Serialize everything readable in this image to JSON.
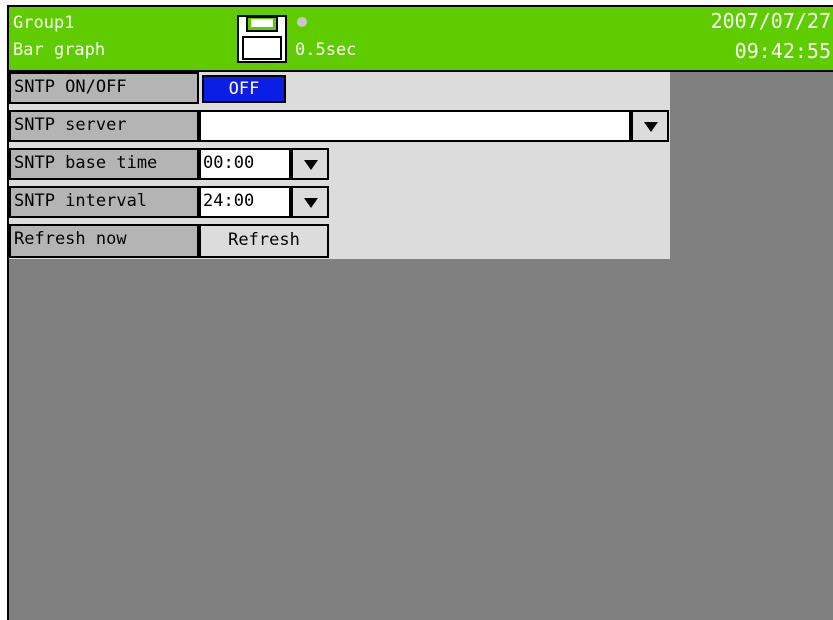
{
  "header": {
    "group_name": "Group1",
    "view_name": "Bar graph",
    "scan_rate": "0.5sec",
    "date": "2007/07/27",
    "time": "09:42:55",
    "icons": [
      "floppy-disk-icon",
      "status-dot-icon"
    ]
  },
  "settings": {
    "sntp_onoff": {
      "label": "SNTP ON/OFF",
      "value": "OFF"
    },
    "sntp_server": {
      "label": "SNTP server",
      "value": ""
    },
    "sntp_base_time": {
      "label": "SNTP base time",
      "value": "00:00"
    },
    "sntp_interval": {
      "label": "SNTP interval",
      "value": "24:00"
    },
    "refresh_now": {
      "label": "Refresh now",
      "button_label": "Refresh"
    }
  },
  "colors": {
    "header_bg": "#5fcc00",
    "background": "#808080",
    "panel_bg": "#dcdcdc",
    "label_bg": "#b4b4b4",
    "selected_bg": "#0a1ee6"
  }
}
